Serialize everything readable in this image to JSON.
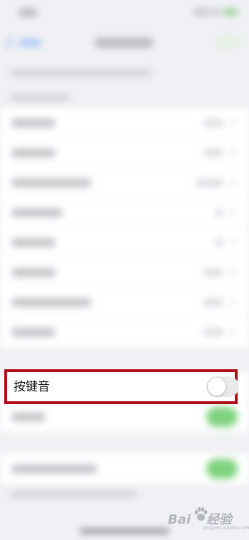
{
  "highlighted_row": {
    "label": "按键音",
    "toggle_state": "off"
  },
  "watermark": {
    "brand_prefix": "Bai",
    "brand_suffix": "经验",
    "sub": "jingyan.baidu.com"
  },
  "colors": {
    "highlight_border": "#b00d16",
    "toggle_on": "#4cd964",
    "toggle_off": "#e9e9ec",
    "background": "#f1f1f5"
  }
}
